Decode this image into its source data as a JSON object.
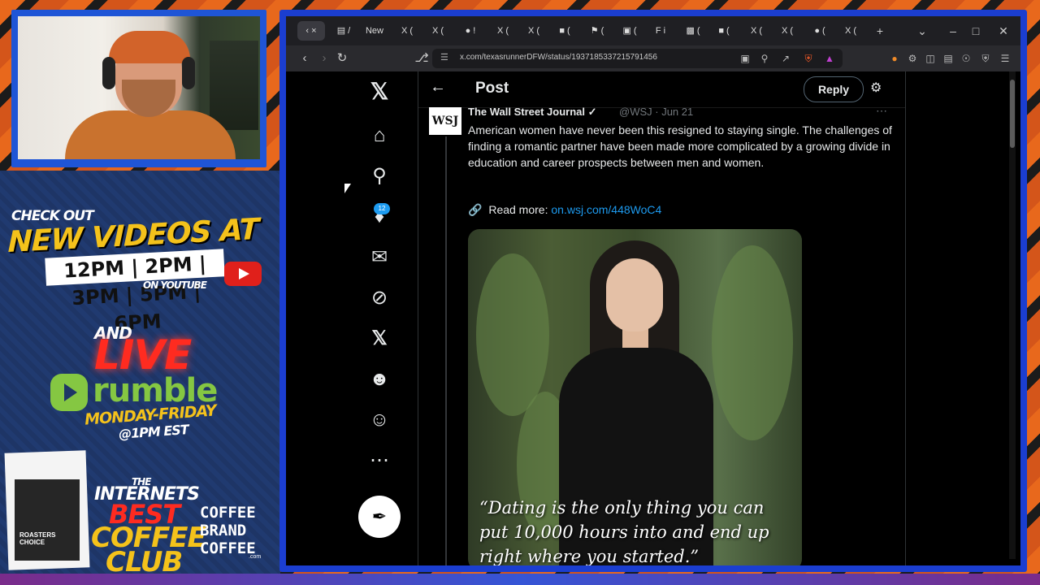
{
  "overlay": {
    "check_out": "CHECK OUT",
    "new_videos_at": "NEW VIDEOS AT",
    "times": "12PM | 2PM | 3PM | 5PM | 6PM",
    "on_youtube": "ON YOUTUBE",
    "and": "AND",
    "live": "LIVE",
    "rumble": "rumble",
    "days": "MONDAY-FRIDAY",
    "time_est": "@1PM EST",
    "the": "THE",
    "internets": "INTERNETS",
    "best": "BEST",
    "coffee": "COFFEE",
    "club": "CLUB",
    "brand_lines": [
      "COFFEE",
      "BRAND",
      "COFFEE"
    ],
    "brand_com": ".com",
    "bag_label": "ROASTERS CHOICE"
  },
  "browser": {
    "tabs": [
      "‹ ×",
      "▤ /",
      "New",
      "X (",
      "X (",
      "● !",
      "X (",
      "X (",
      "■ (",
      "⚑ (",
      "▣ (",
      "F i",
      "▩ (",
      "■ (",
      "X (",
      "X (",
      "● (",
      "X ("
    ],
    "new_tab": "+",
    "url": "x.com/texasrunnerDFW/status/1937185337215791456"
  },
  "x_app": {
    "nav": [
      "home",
      "search",
      "notifications",
      "messages",
      "grok",
      "x",
      "communities",
      "profile",
      "more"
    ],
    "notification_count": "12",
    "header_title": "Post",
    "reply_label": "Reply",
    "tweet": {
      "avatar_text": "WSJ",
      "author": "The Wall Street Journal ✓",
      "handle": "@WSJ · Jun 21",
      "text": "American women have never been this resigned to staying single. The challenges of finding a romantic partner have been made more complicated by a growing divide in education and career prospects between men and women.",
      "read_more_label": "Read more:",
      "read_more_link": "on.wsj.com/448WoC4",
      "image_quote": "“Dating is the only thing you can put 10,000 hours into and end up right where you started.”"
    }
  },
  "colors": {
    "x_blue": "#1d9bf0",
    "overlay_orange": "#e8681c",
    "frame_blue": "#1b3ed0",
    "promo_yellow": "#f4c21b",
    "live_red": "#ff2b20",
    "rumble_green": "#85c742"
  }
}
